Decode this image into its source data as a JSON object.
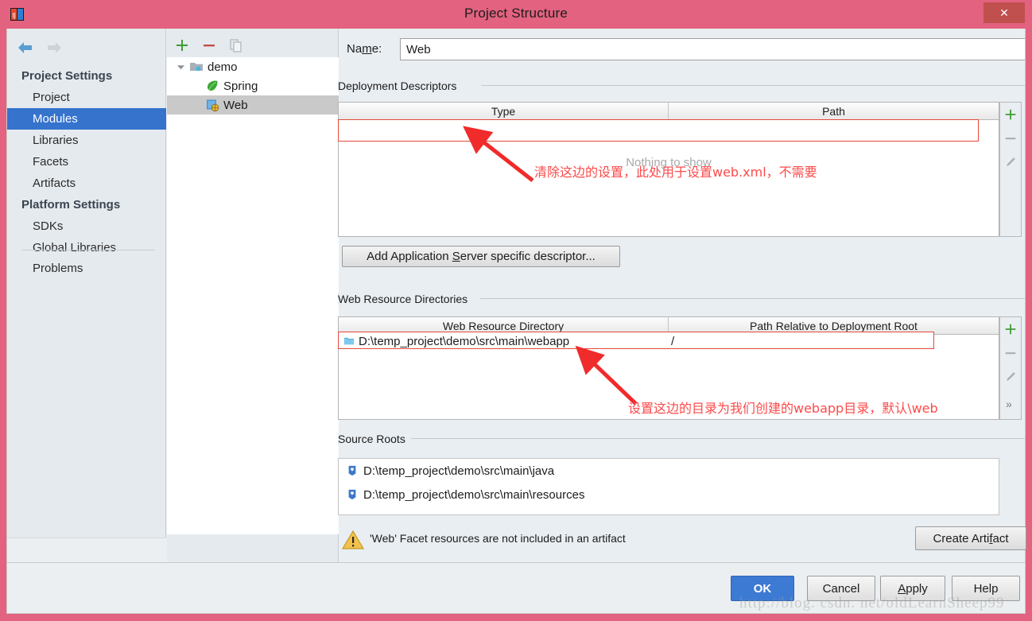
{
  "window": {
    "title": "Project Structure",
    "close_label": "✕",
    "app_icon": "intellij-idea-icon"
  },
  "sidebar": {
    "nav": {
      "back": "back-arrow-icon",
      "forward": "forward-arrow-icon"
    },
    "groups": [
      {
        "label": "Project Settings",
        "items": [
          "Project",
          "Modules",
          "Libraries",
          "Facets",
          "Artifacts"
        ]
      },
      {
        "label": "Platform Settings",
        "items": [
          "SDKs",
          "Global Libraries"
        ]
      }
    ],
    "selected": "Modules",
    "problems_label": "Problems"
  },
  "tree": {
    "toolbar": [
      "add-icon",
      "remove-icon",
      "copy-icon"
    ],
    "nodes": [
      {
        "label": "demo",
        "icon": "module-folder-icon",
        "level": 0,
        "expanded": true,
        "selected": false
      },
      {
        "label": "Spring",
        "icon": "spring-leaf-icon",
        "level": 1,
        "expanded": false,
        "selected": false
      },
      {
        "label": "Web",
        "icon": "web-facet-icon",
        "level": 1,
        "expanded": false,
        "selected": true
      }
    ]
  },
  "main": {
    "name_label": "Name:",
    "name_value": "Web",
    "deployment": {
      "group_label": "Deployment Descriptors",
      "columns": [
        "Type",
        "Path"
      ],
      "rows": [],
      "empty_text": "Nothing to show",
      "tools": [
        "add-icon",
        "remove-icon",
        "edit-pencil-icon"
      ],
      "add_button": "Add Application Server specific descriptor..."
    },
    "web_resources": {
      "group_label": "Web Resource Directories",
      "columns": [
        "Web Resource Directory",
        "Path Relative to Deployment Root"
      ],
      "rows": [
        {
          "directory": "D:\\temp_project\\demo\\src\\main\\webapp",
          "relative_path": "/",
          "icon": "folder-icon"
        }
      ],
      "tools": [
        "add-icon",
        "remove-icon",
        "edit-pencil-icon",
        "expand-chevrons-icon"
      ]
    },
    "source_roots": {
      "group_label": "Source Roots",
      "rows": [
        {
          "path": "D:\\temp_project\\demo\\src\\main\\java",
          "icon": "source-root-icon"
        },
        {
          "path": "D:\\temp_project\\demo\\src\\main\\resources",
          "icon": "source-root-icon"
        }
      ]
    },
    "warning": {
      "icon": "warning-triangle-icon",
      "text": "'Web' Facet resources are not included in an artifact",
      "button": "Create Artifact"
    }
  },
  "footer": {
    "ok": "OK",
    "cancel": "Cancel",
    "apply": "Apply",
    "help": "Help"
  },
  "annotations": [
    {
      "id": "anno-1",
      "text": "清除这边的设置，此处用于设置web.xml，不需要"
    },
    {
      "id": "anno-2",
      "text": "设置这边的目录为我们创建的webapp目录，默认\\web"
    }
  ],
  "watermark": "http://blog. csdn. net/oldLearnSheep99",
  "colors": {
    "title_bar": "#e2627f",
    "accent_selection": "#3573cd",
    "ok_button": "#3d7ad4",
    "annotation_red": "#fc4a4a",
    "close_button": "#c0504d"
  }
}
